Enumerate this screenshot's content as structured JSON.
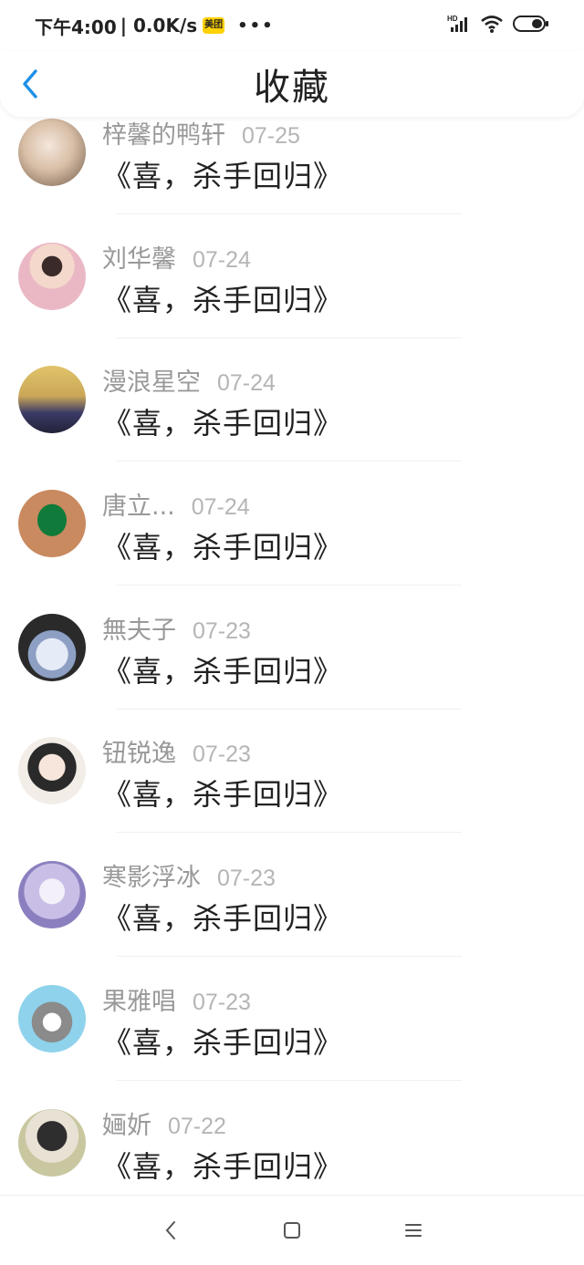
{
  "status_bar": {
    "time": "下午4:00",
    "speed": "| 0.0K/s",
    "app_badge": "美团",
    "more": "•••",
    "network_label": "HD"
  },
  "header": {
    "title": "收藏"
  },
  "items": [
    {
      "name": "梓馨的鸭轩",
      "date": "07-25",
      "content": "《喜，杀手回归》",
      "avatar_colors": [
        "#e8d6c6",
        "#6e5a4a"
      ]
    },
    {
      "name": "刘华馨",
      "date": "07-24",
      "content": "《喜，杀手回归》",
      "avatar_colors": [
        "#f1d1d8",
        "#2b2b2b"
      ]
    },
    {
      "name": "漫浪星空",
      "date": "07-24",
      "content": "《喜，杀手回归》",
      "avatar_colors": [
        "#e0c46a",
        "#2a2a4a"
      ]
    },
    {
      "name": "唐立...",
      "date": "07-24",
      "content": "《喜，杀手回归》",
      "avatar_colors": [
        "#c98a60",
        "#0f7a3a"
      ]
    },
    {
      "name": "無夫子",
      "date": "07-23",
      "content": "《喜，杀手回归》",
      "avatar_colors": [
        "#2a2a2a",
        "#c9d4e8"
      ]
    },
    {
      "name": "钮锐逸",
      "date": "07-23",
      "content": "《喜，杀手回归》",
      "avatar_colors": [
        "#f3ede8",
        "#2a2a2a"
      ]
    },
    {
      "name": "寒影浮冰",
      "date": "07-23",
      "content": "《喜，杀手回归》",
      "avatar_colors": [
        "#e9e4f4",
        "#8b7fbf"
      ]
    },
    {
      "name": "果雅唱",
      "date": "07-23",
      "content": "《喜，杀手回归》",
      "avatar_colors": [
        "#8fd2ec",
        "#8b8b8b"
      ]
    },
    {
      "name": "婳妡",
      "date": "07-22",
      "content": "《喜，杀手回归》",
      "avatar_colors": [
        "#c8c7a0",
        "#2e2e2e"
      ]
    }
  ],
  "colors": {
    "accent": "#1e90e6",
    "name_text": "#999999",
    "date_text": "#b5b5b5",
    "content_text": "#222222"
  }
}
